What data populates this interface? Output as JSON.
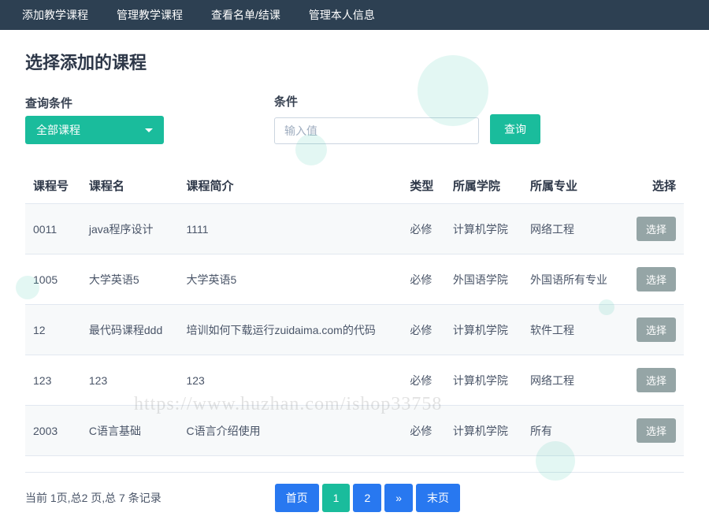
{
  "nav": {
    "items": [
      "添加教学课程",
      "管理教学课程",
      "查看名单/结课",
      "管理本人信息"
    ]
  },
  "page_title": "选择添加的课程",
  "filter": {
    "dropdown_label": "查询条件",
    "dropdown_value": "全部课程",
    "input_label": "条件",
    "input_placeholder": "输入值",
    "query_btn": "查询"
  },
  "table": {
    "headers": [
      "课程号",
      "课程名",
      "课程简介",
      "类型",
      "所属学院",
      "所属专业",
      "选择"
    ],
    "rows": [
      {
        "id": "0011",
        "name": "java程序设计",
        "desc": "1111",
        "type": "必修",
        "college": "计算机学院",
        "major": "网络工程"
      },
      {
        "id": "1005",
        "name": "大学英语5",
        "desc": "大学英语5",
        "type": "必修",
        "college": "外国语学院",
        "major": "外国语所有专业"
      },
      {
        "id": "12",
        "name": "最代码课程ddd",
        "desc": "培训如何下载运行zuidaima.com的代码",
        "type": "必修",
        "college": "计算机学院",
        "major": "软件工程"
      },
      {
        "id": "123",
        "name": "123",
        "desc": "123",
        "type": "必修",
        "college": "计算机学院",
        "major": "网络工程"
      },
      {
        "id": "2003",
        "name": "C语言基础",
        "desc": "C语言介绍使用",
        "type": "必修",
        "college": "计算机学院",
        "major": "所有"
      }
    ],
    "select_label": "选择"
  },
  "pagination": {
    "summary": "当前 1页,总2 页,总 7 条记录",
    "first": "首页",
    "pages": [
      "1",
      "2"
    ],
    "next": "»",
    "last": "末页",
    "current": "1"
  },
  "watermark": "https://www.huzhan.com/ishop33758"
}
